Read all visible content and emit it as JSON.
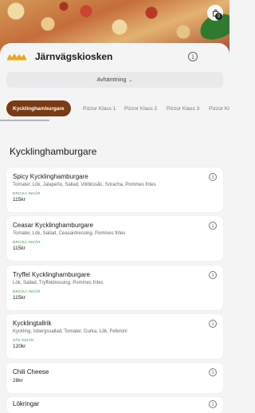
{
  "header": {
    "store_name": "Järnvägskiosken",
    "logo_icon": "logo-crown-icon",
    "cart_badge": "0",
    "pickup_label": "Avhämtning"
  },
  "tabs": [
    {
      "label": "Kycklinghamburgare",
      "active": true
    },
    {
      "label": "Pizzor Klass 1",
      "active": false
    },
    {
      "label": "Pizzor Klass 2",
      "active": false
    },
    {
      "label": "Pizzor Klass 3",
      "active": false
    },
    {
      "label": "Pizzor Kla",
      "active": false
    }
  ],
  "section": {
    "title": "Kycklinghamburgare"
  },
  "menu_items": [
    {
      "title": "Spicy Kycklinghamburgare",
      "description": "Tomater, Lök, Jalapeño, Sallad, Vitlökssås, Sriracha, Pommes frites",
      "tag": "DRICKA INGÅR",
      "price": "115kr"
    },
    {
      "title": "Ceasar Kycklinghamburgare",
      "description": "Tomater, Lök, Sallad, Ceasardressing, Pommes frites",
      "tag": "DRICKA INGÅR",
      "price": "115kr"
    },
    {
      "title": "Tryffel Kycklinghamburgare",
      "description": "Lök, Sallad, Tryffeldressing, Pommes frites",
      "tag": "DRICKA INGÅR",
      "price": "115kr"
    },
    {
      "title": "Kycklingtallrik",
      "description": "Kyckling, Isbergssallad, Tomater, Gurka, Lök, Feferoni",
      "tag": "SÅS INGÅR",
      "price": "120kr"
    },
    {
      "title": "Chili Cheese",
      "description": "",
      "tag": "",
      "price": "28kr"
    },
    {
      "title": "Lökringar",
      "description": "",
      "tag": "",
      "price": ""
    }
  ],
  "colors": {
    "accent_tab": "#7a3a14",
    "tag_green": "#3a9a47",
    "logo_gold": "#e8a91c"
  }
}
